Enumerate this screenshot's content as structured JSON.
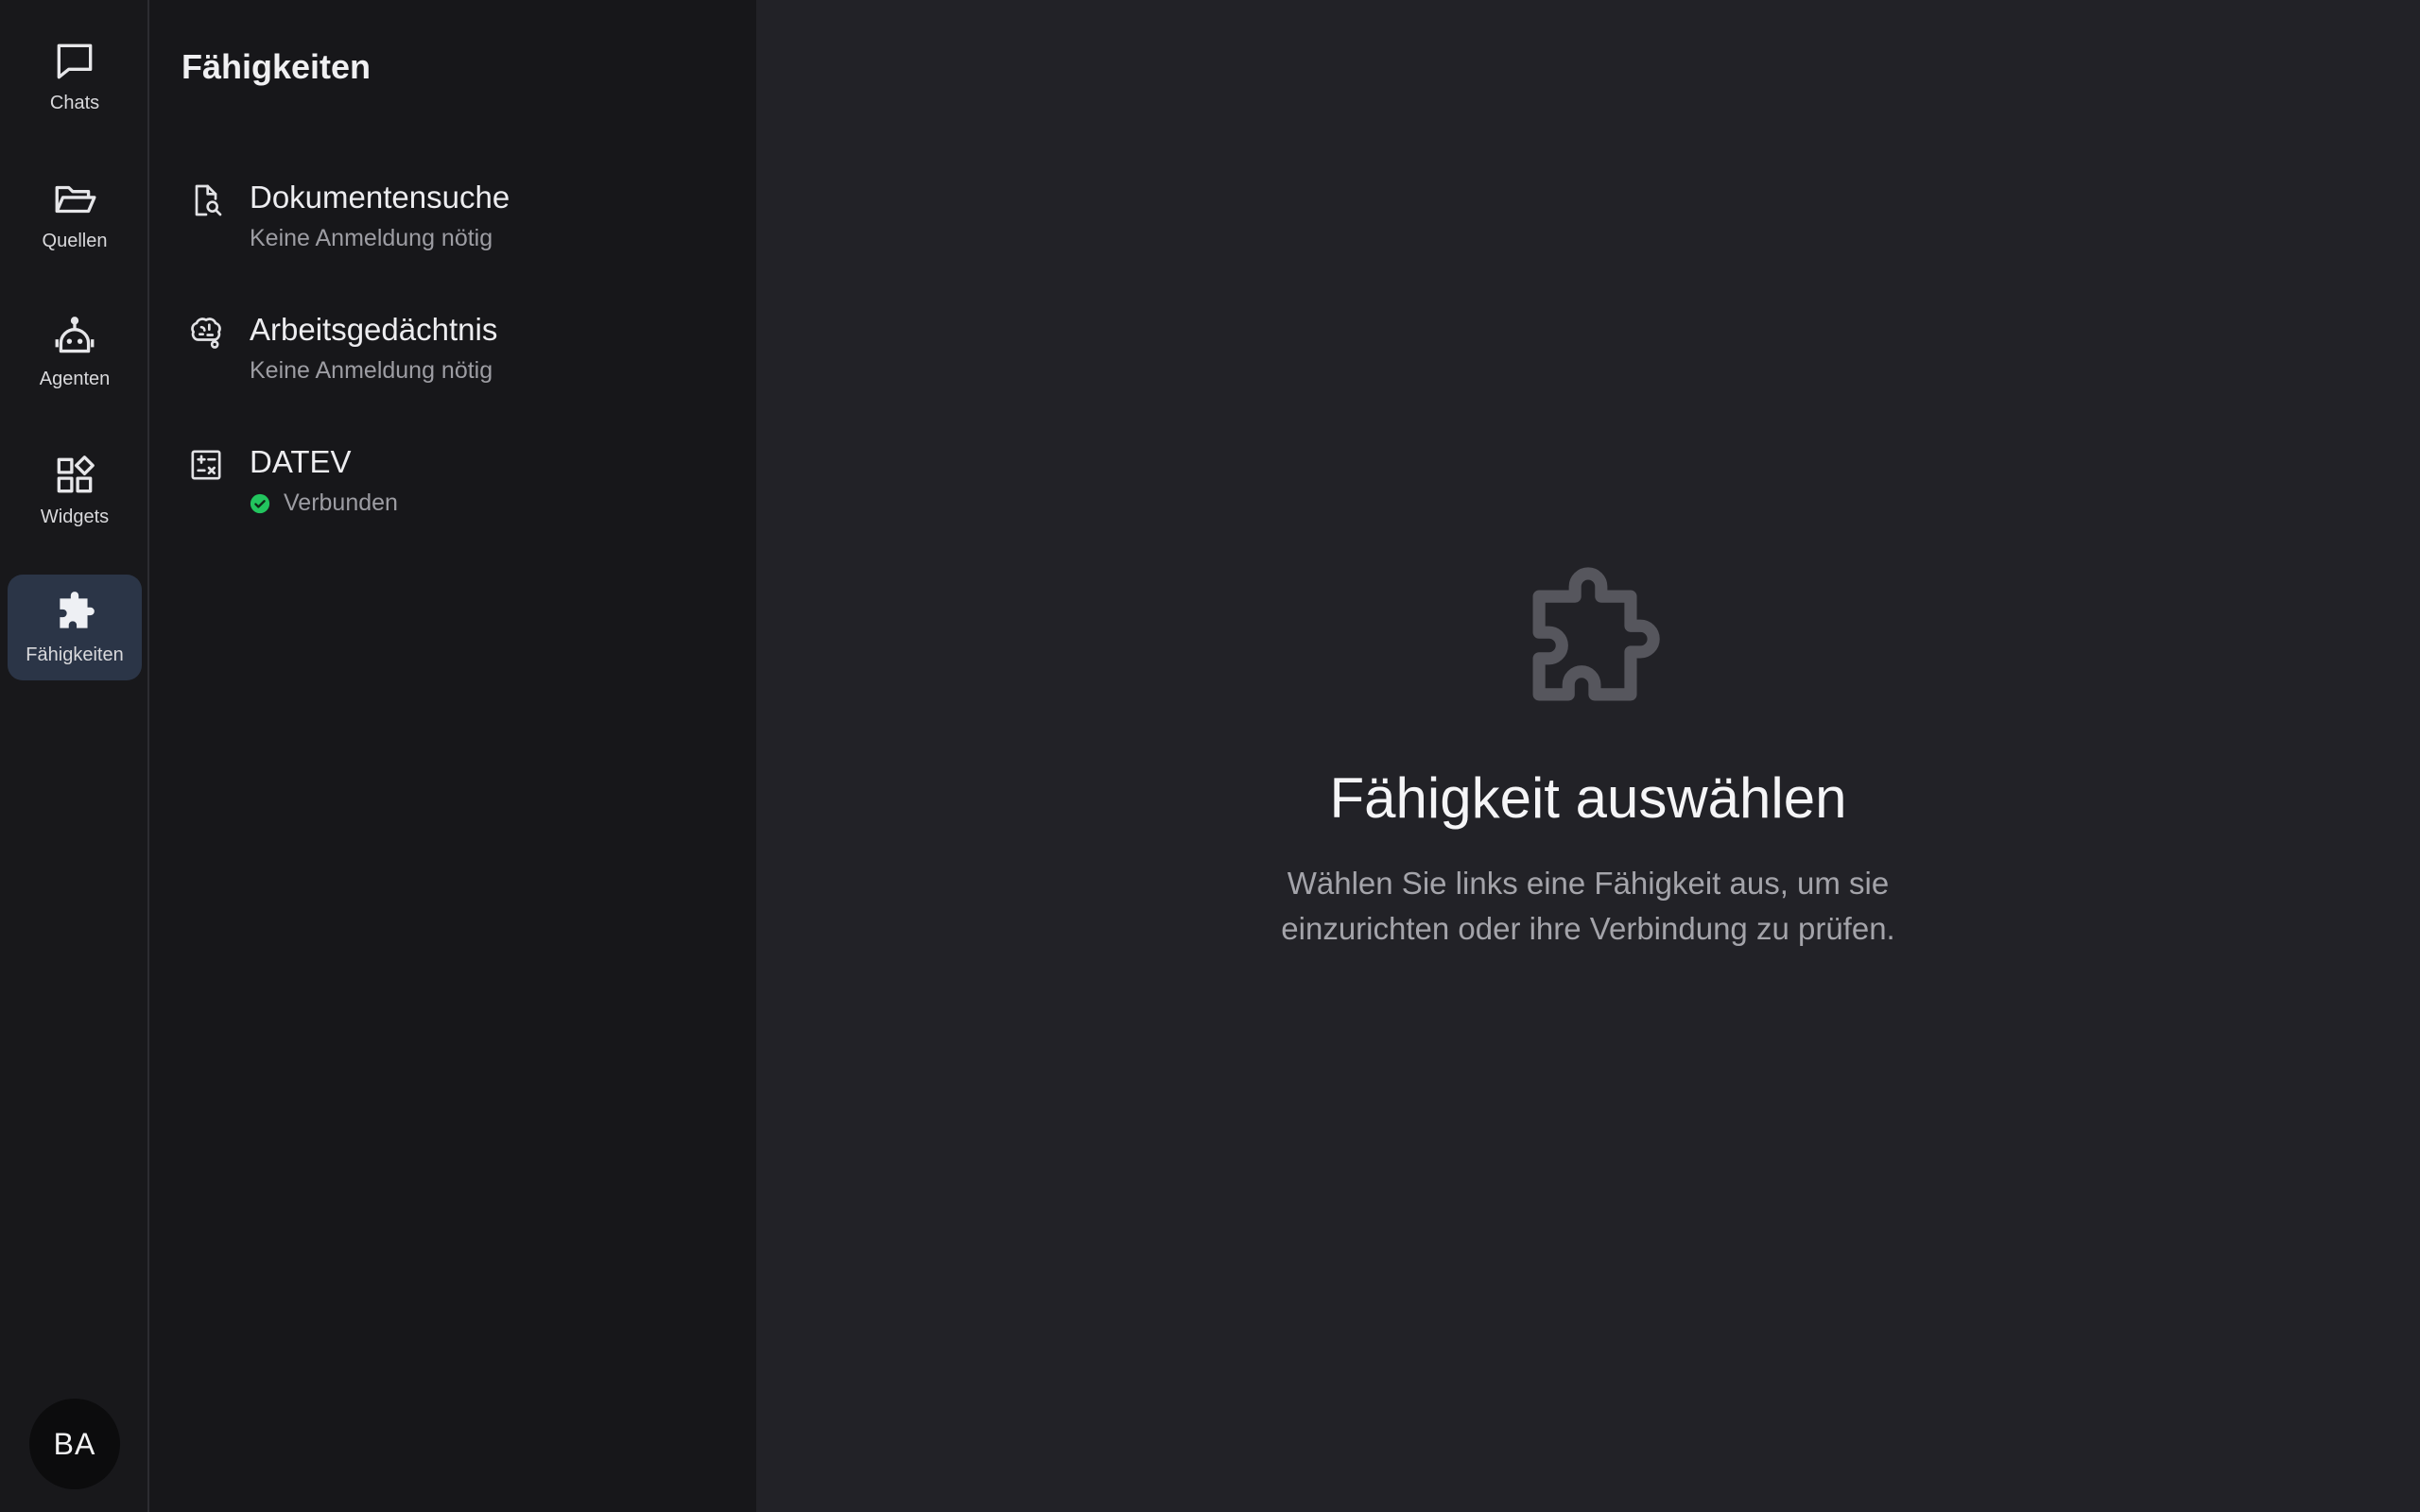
{
  "rail": {
    "items": [
      {
        "label": "Chats",
        "icon": "chat-bubble-icon"
      },
      {
        "label": "Quellen",
        "icon": "folder-open-icon"
      },
      {
        "label": "Agenten",
        "icon": "robot-icon"
      },
      {
        "label": "Widgets",
        "icon": "widgets-icon"
      },
      {
        "label": "Fähigkeiten",
        "icon": "puzzle-icon",
        "active": true
      }
    ],
    "avatar_initials": "BA"
  },
  "panel": {
    "title": "Fähigkeiten",
    "skills": [
      {
        "name": "Dokumentensuche",
        "status": "Keine Anmeldung nötig",
        "icon": "document-search-icon"
      },
      {
        "name": "Arbeitsgedächtnis",
        "status": "Keine Anmeldung nötig",
        "icon": "brain-icon"
      },
      {
        "name": "DATEV",
        "status": "Verbunden",
        "icon": "calculator-icon",
        "connected": true
      }
    ]
  },
  "main": {
    "empty_title": "Fähigkeit auswählen",
    "empty_description": "Wählen Sie links eine Fähigkeit aus, um sie einzurichten oder ihre Verbindung zu prüfen.",
    "icon": "puzzle-icon"
  },
  "colors": {
    "accent_active": "#2b3547",
    "status_connected": "#22c55e"
  }
}
